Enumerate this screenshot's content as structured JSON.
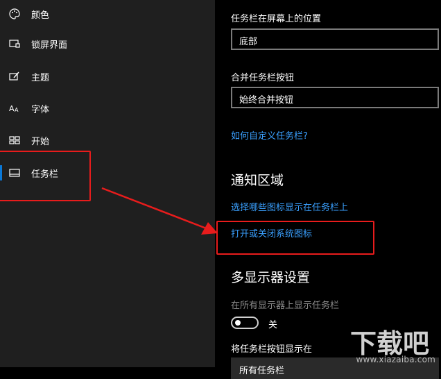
{
  "sidebar": {
    "items": [
      {
        "label": "颜色",
        "icon": "palette-icon"
      },
      {
        "label": "锁屏界面",
        "icon": "lock-screen-icon"
      },
      {
        "label": "主题",
        "icon": "theme-brush-icon"
      },
      {
        "label": "字体",
        "icon": "font-icon"
      },
      {
        "label": "开始",
        "icon": "start-icon"
      },
      {
        "label": "任务栏",
        "icon": "taskbar-icon",
        "selected": true
      }
    ]
  },
  "main": {
    "position_label": "任务栏在屏幕上的位置",
    "position_value": "底部",
    "combine_label": "合并任务栏按钮",
    "combine_value": "始终合并按钮",
    "customize_link": "如何自定义任务栏?",
    "notification_heading": "通知区域",
    "select_icons_link": "选择哪些图标显示在任务栏上",
    "system_icons_link": "打开或关闭系统图标",
    "multi_display_heading": "多显示器设置",
    "show_all_displays_label": "在所有显示器上显示任务栏",
    "toggle_state": "关",
    "buttons_on_label": "将任务栏按钮显示在",
    "buttons_on_value": "所有任务栏"
  },
  "watermark": {
    "text": "下载吧",
    "url": "www.xiazaiba.com"
  },
  "colors": {
    "accent": "#0a78d7",
    "link": "#3aa0ff",
    "annotation": "#e81c1c"
  }
}
